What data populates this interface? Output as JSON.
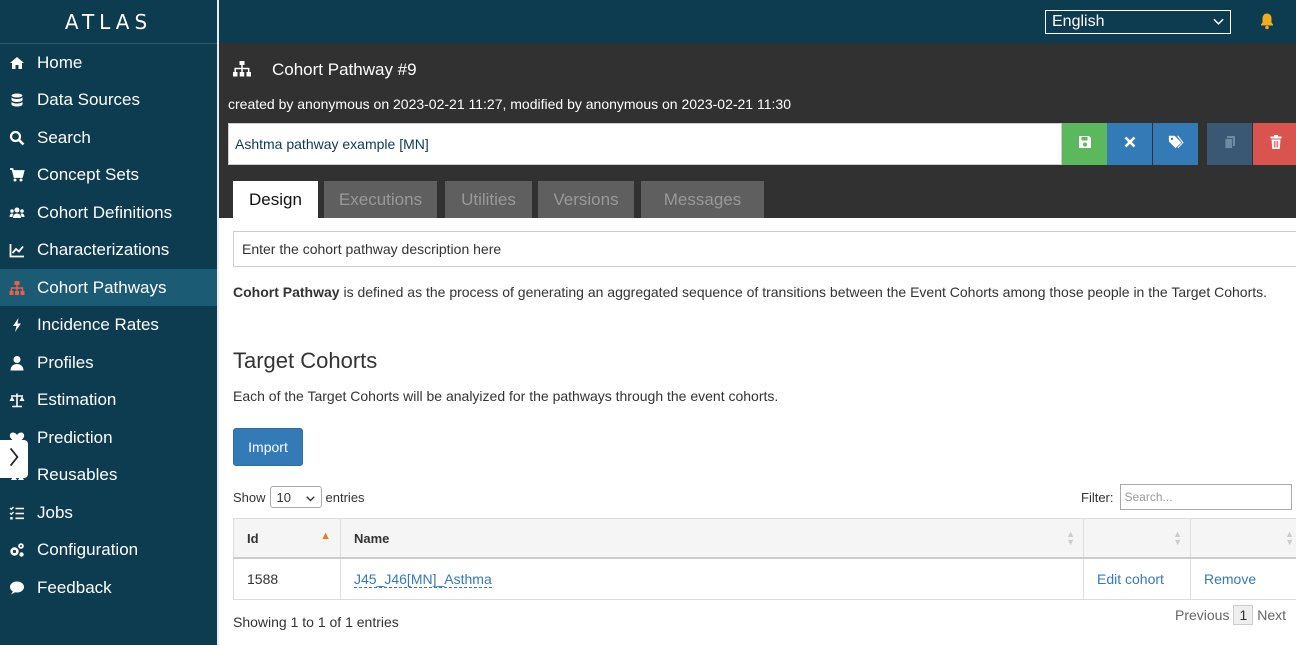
{
  "app": {
    "brand": "ATLAS"
  },
  "sidebar": {
    "items": [
      {
        "label": "Home",
        "icon": "home-icon"
      },
      {
        "label": "Data Sources",
        "icon": "database-icon"
      },
      {
        "label": "Search",
        "icon": "search-icon"
      },
      {
        "label": "Concept Sets",
        "icon": "cart-icon"
      },
      {
        "label": "Cohort Definitions",
        "icon": "users-icon"
      },
      {
        "label": "Characterizations",
        "icon": "chart-line-icon"
      },
      {
        "label": "Cohort Pathways",
        "icon": "sitemap-icon",
        "active": true
      },
      {
        "label": "Incidence Rates",
        "icon": "bolt-icon"
      },
      {
        "label": "Profiles",
        "icon": "user-icon"
      },
      {
        "label": "Estimation",
        "icon": "balance-scale-icon"
      },
      {
        "label": "Prediction",
        "icon": "heartbeat-icon"
      },
      {
        "label": "Reusables",
        "icon": "recycle-icon"
      },
      {
        "label": "Jobs",
        "icon": "tasks-icon"
      },
      {
        "label": "Configuration",
        "icon": "cogs-icon"
      },
      {
        "label": "Feedback",
        "icon": "comment-icon"
      }
    ]
  },
  "topbar": {
    "language": "English",
    "notification_icon": "bell-icon"
  },
  "header": {
    "title": "Cohort Pathway #9",
    "meta": "created by anonymous on 2023-02-21 11:27, modified by anonymous on 2023-02-21 11:30",
    "name_value": "Ashtma pathway example [MN]",
    "buttons": [
      {
        "name": "save",
        "icon": "save-icon",
        "color": "#5cb85c"
      },
      {
        "name": "close",
        "icon": "close-icon",
        "color": "#337ab7"
      },
      {
        "name": "tags",
        "icon": "tags-icon",
        "color": "#337ab7"
      },
      {
        "name": "copy",
        "icon": "copy-icon",
        "color": "#3a5773"
      },
      {
        "name": "delete",
        "icon": "trash-icon",
        "color": "#d9534f"
      }
    ],
    "tabs": [
      {
        "label": "Design",
        "active": true
      },
      {
        "label": "Executions"
      },
      {
        "label": "Utilities"
      },
      {
        "label": "Versions"
      },
      {
        "label": "Messages"
      }
    ]
  },
  "content": {
    "description_value": "Enter the cohort pathway description here",
    "definition_bold": "Cohort Pathway",
    "definition_rest": " is defined as the process of generating an aggregated sequence of transitions between the Event Cohorts among those people in the Target Cohorts.",
    "section_title": "Target Cohorts",
    "section_desc": "Each of the Target Cohorts will be analyized for the pathways through the event cohorts.",
    "import_label": "Import",
    "show_label": "Show",
    "page_length": "10",
    "entries_label": "entries",
    "filter_label": "Filter:",
    "filter_placeholder": "Search...",
    "table": {
      "columns": [
        "Id",
        "Name",
        "",
        ""
      ],
      "rows": [
        {
          "id": "1588",
          "name": "J45_J46[MN]_Asthma",
          "edit": "Edit cohort",
          "remove": "Remove"
        }
      ]
    },
    "info": "Showing 1 to 1 of 1 entries",
    "paging": {
      "previous": "Previous",
      "current": "1",
      "next": "Next"
    }
  }
}
